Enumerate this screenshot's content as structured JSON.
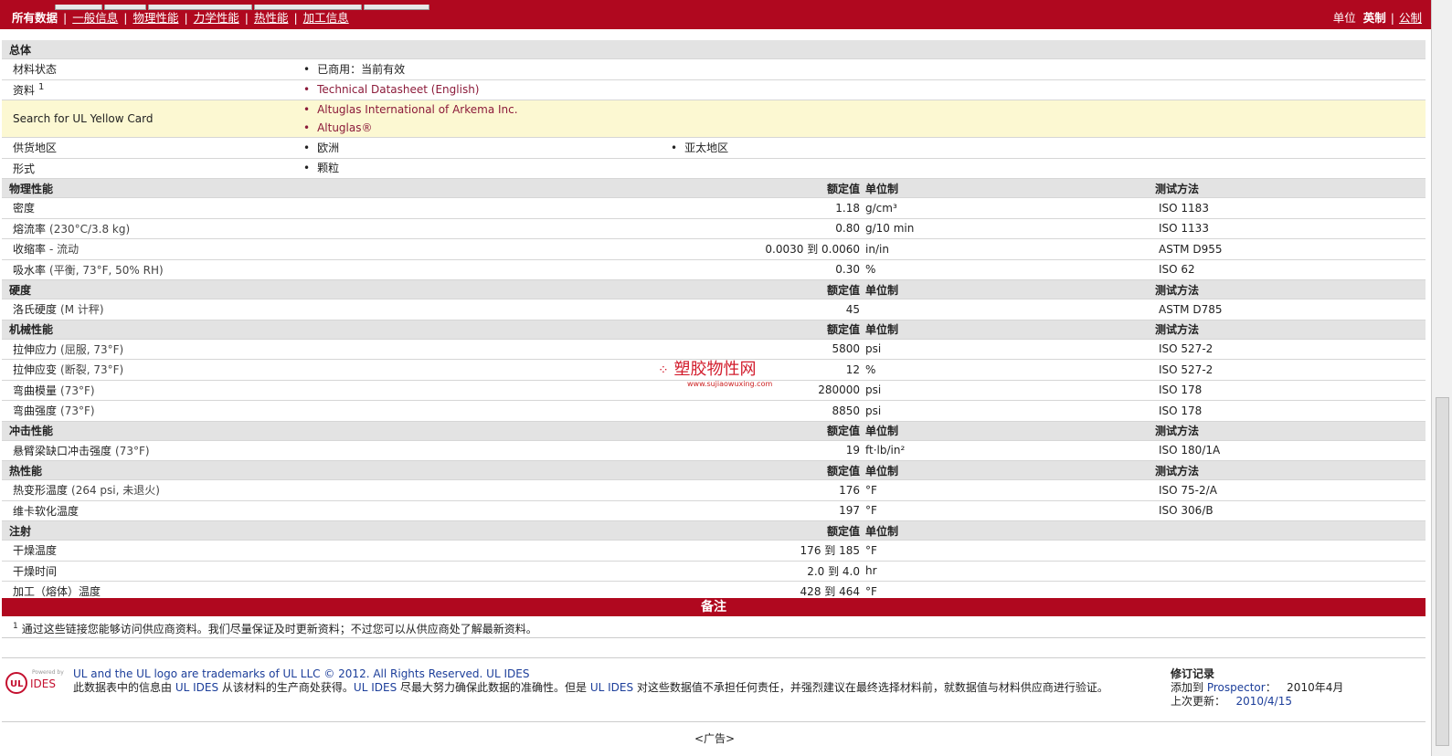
{
  "nav": {
    "active": "所有数据",
    "links": [
      "一般信息",
      "物理性能",
      "力学性能",
      "热性能",
      "加工信息"
    ]
  },
  "units": {
    "label": "单位",
    "current": "英制",
    "other": "公制"
  },
  "general": {
    "title": "总体",
    "rows": [
      {
        "label": "材料状态",
        "values": [
          "已商用：当前有效"
        ]
      },
      {
        "label": "资料",
        "sup": "1",
        "values": [
          "Technical Datasheet (English)"
        ],
        "link": true
      },
      {
        "label": "Search for UL Yellow Card",
        "values": [
          "Altuglas International of Arkema Inc.",
          "Altuglas®"
        ],
        "link": true,
        "highlight": true
      },
      {
        "label": "供货地区",
        "values": [
          "欧洲",
          "亚太地区"
        ]
      },
      {
        "label": "形式",
        "values": [
          "颗粒"
        ]
      }
    ]
  },
  "headers": {
    "value": "额定值",
    "unit": "单位制",
    "method": "测试方法"
  },
  "sections": [
    {
      "title": "物理性能",
      "show_method": true,
      "rows": [
        {
          "label": "密度",
          "cond": "",
          "value": "1.18",
          "unit": "g/cm³",
          "method": "ISO 1183"
        },
        {
          "label": "熔流率",
          "cond": "(230°C/3.8 kg)",
          "value": "0.80",
          "unit": "g/10 min",
          "method": "ISO 1133"
        },
        {
          "label": "收缩率",
          "cond": "- 流动",
          "value": "0.0030 到  0.0060",
          "unit": "in/in",
          "method": "ASTM D955"
        },
        {
          "label": "吸水率",
          "cond": "(平衡, 73°F, 50% RH)",
          "value": "0.30",
          "unit": "%",
          "method": "ISO 62"
        }
      ]
    },
    {
      "title": "硬度",
      "show_method": true,
      "rows": [
        {
          "label": "洛氏硬度",
          "cond": "(M 计秤)",
          "value": "45",
          "unit": "",
          "method": "ASTM D785"
        }
      ]
    },
    {
      "title": "机械性能",
      "show_method": true,
      "rows": [
        {
          "label": "拉伸应力",
          "cond": "(屈服, 73°F)",
          "value": "5800",
          "unit": "psi",
          "method": "ISO 527-2"
        },
        {
          "label": "拉伸应变",
          "cond": "(断裂, 73°F)",
          "value": "12",
          "unit": "%",
          "method": "ISO 527-2"
        },
        {
          "label": "弯曲模量",
          "cond": "(73°F)",
          "value": "280000",
          "unit": "psi",
          "method": "ISO 178"
        },
        {
          "label": "弯曲强度",
          "cond": "(73°F)",
          "value": "8850",
          "unit": "psi",
          "method": "ISO 178"
        }
      ]
    },
    {
      "title": "冲击性能",
      "show_method": true,
      "rows": [
        {
          "label": "悬臂梁缺口冲击强度",
          "cond": "(73°F)",
          "value": "19",
          "unit": "ft·lb/in²",
          "method": "ISO 180/1A"
        }
      ]
    },
    {
      "title": "热性能",
      "show_method": true,
      "rows": [
        {
          "label": "热变形温度",
          "cond": "(264 psi, 未退火)",
          "value": "176",
          "unit": "°F",
          "method": "ISO 75-2/A"
        },
        {
          "label": "维卡软化温度",
          "cond": "",
          "value": "197",
          "unit": "°F",
          "method": "ISO 306/B"
        }
      ]
    },
    {
      "title": "注射",
      "show_method": false,
      "rows": [
        {
          "label": "干燥温度",
          "cond": "",
          "value": "176 到  185",
          "unit": "°F",
          "method": ""
        },
        {
          "label": "干燥时间",
          "cond": "",
          "value": "2.0 到  4.0",
          "unit": "hr",
          "method": ""
        },
        {
          "label": "加工（熔体）温度",
          "cond": "",
          "value": "428 到  464",
          "unit": "°F",
          "method": ""
        }
      ]
    }
  ],
  "notes": {
    "title": "备注",
    "sup": "1",
    "text": "通过这些链接您能够访问供应商资料。我们尽量保证及时更新资料；不过您可以从供应商处了解最新资料。"
  },
  "footer": {
    "logo_small": "Powered by",
    "logo_ul": "UL",
    "logo_ides": "IDES",
    "line1": "UL and the UL logo are trademarks of UL LLC © 2012. All Rights Reserved. UL IDES",
    "line2a": "此数据表中的信息由 ",
    "line2b": "UL IDES",
    "line2c": " 从该材料的生产商处获得。",
    "line2d": "UL IDES",
    "line2e": " 尽最大努力确保此数据的准确性。但是 ",
    "line2f": "UL IDES",
    "line2g": " 对这些数据值不承担任何责任，并强烈建议在最终选择材料前，就数据值与材料供应商进行验证。",
    "rev_title": "修订记录",
    "added_label": "添加到 ",
    "added_link": "Prospector",
    ":": "：",
    "added_date": "2010年4月",
    "updated_label": "上次更新：",
    "updated_date": "2010/4/15"
  },
  "ad": "<广告>",
  "watermark": {
    "text": "塑胶物性网",
    "sub": "www.sujiaowuxing.com"
  }
}
